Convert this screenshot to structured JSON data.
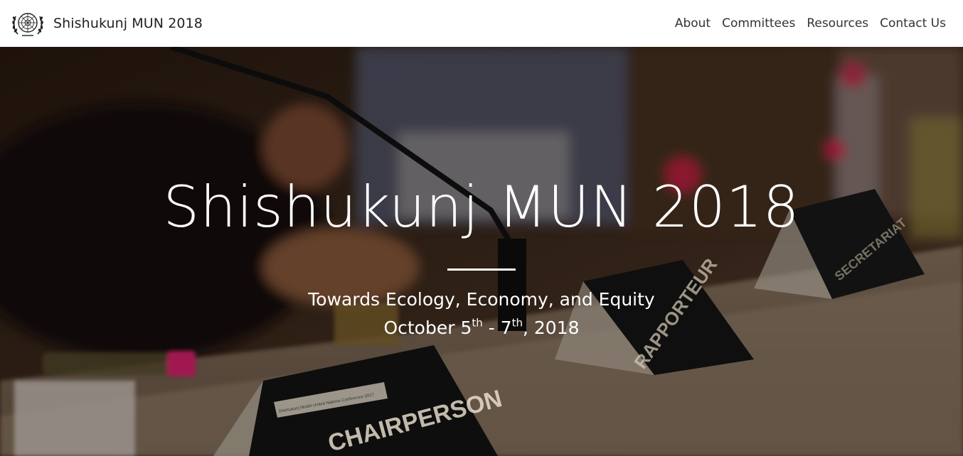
{
  "navbar": {
    "brand_text": "Shishukunj MUN 2018",
    "logo_icon": "un-emblem-icon",
    "links": [
      {
        "label": "About"
      },
      {
        "label": "Committees"
      },
      {
        "label": "Resources"
      },
      {
        "label": "Contact Us"
      }
    ]
  },
  "hero": {
    "title": "Shishukunj MUN 2018",
    "tagline": "Towards Ecology, Economy, and Equity",
    "dates": {
      "month": "October",
      "start_day": "5",
      "start_suffix": "th",
      "separator": "-",
      "end_day": "7",
      "end_suffix": "th",
      "year": "2018"
    },
    "placard_labels": [
      "CHAIRPERSON",
      "RAPPORTEUR",
      "SECRETARIAT",
      "Shishukunj Model United Nations Conference 2017"
    ]
  },
  "colors": {
    "navbar_bg": "#ffffff",
    "nav_text": "#333333",
    "hero_text": "#ffffff"
  }
}
